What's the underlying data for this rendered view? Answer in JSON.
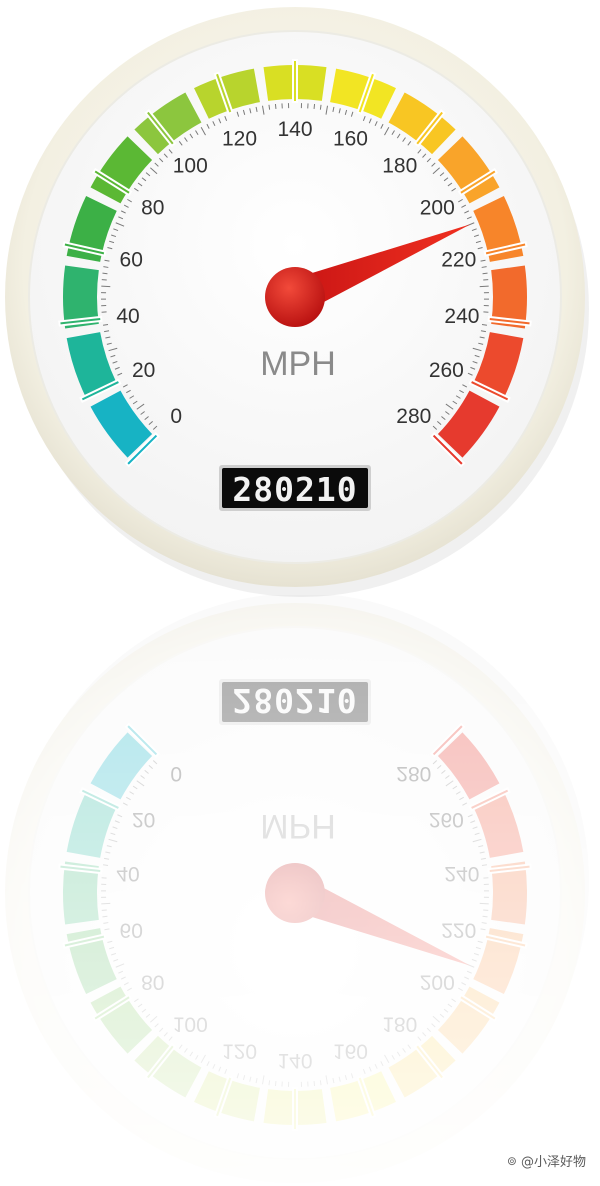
{
  "gauge": {
    "unit_label": "MPH",
    "scale_labels": [
      "0",
      "20",
      "40",
      "60",
      "80",
      "100",
      "120",
      "140",
      "160",
      "180",
      "200",
      "220",
      "240",
      "260",
      "280"
    ],
    "speed_value": 210,
    "odometer": "280210",
    "odometer_mirrored_display": "580510",
    "colors": {
      "needle": "#e01c1c",
      "hub": "#d91818",
      "odometer_bg": "#0b0b0b",
      "odometer_text": "#f2f2f2",
      "bezel": "#f4f1e6",
      "face": "#ffffff",
      "ticks": "#7a7a7a",
      "labels": "#333333",
      "unit": "#8a8a8a"
    },
    "band_colors": [
      "#17b3c4",
      "#1eb59a",
      "#2fb36e",
      "#3cb046",
      "#5bb834",
      "#8cc63e",
      "#b8d42d",
      "#d9df23",
      "#f2e523",
      "#f8c623",
      "#f9a42a",
      "#f7852a",
      "#f26a2c",
      "#ec4a2d",
      "#e63a2e"
    ]
  },
  "watermark": {
    "text": "@小泽好物"
  }
}
